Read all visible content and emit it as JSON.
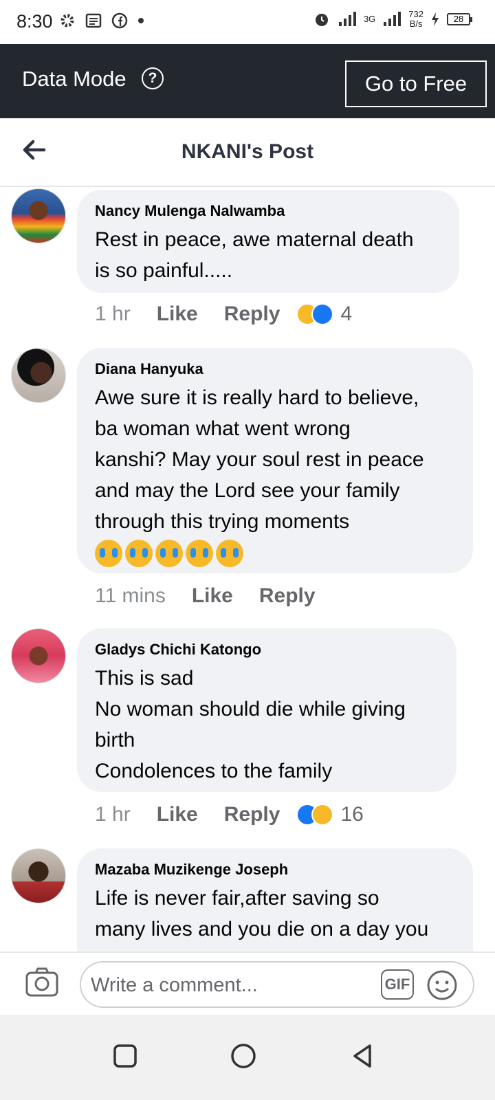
{
  "status_bar": {
    "time": "8:30",
    "network_speed_value": "732",
    "network_speed_unit": "B/s",
    "network_type": "3G",
    "battery": "28"
  },
  "data_mode": {
    "label": "Data Mode",
    "help_glyph": "?",
    "button": "Go to Free"
  },
  "header": {
    "title": "NKANI's Post"
  },
  "comments": [
    {
      "author": "Nancy Mulenga Nalwamba",
      "text": "Rest in peace, awe maternal death\nis so painful.....",
      "time": "1 hr",
      "like": "Like",
      "reply": "Reply",
      "reaction_count": "4"
    },
    {
      "author": "Diana Hanyuka",
      "text": "Awe sure it is really hard to believe,\nba woman what went wrong\nkanshi? May your soul rest in peace\nand may the Lord see your family\nthrough this trying moments",
      "emoji_count": 5,
      "time": "11 mins",
      "like": "Like",
      "reply": "Reply"
    },
    {
      "author": "Gladys Chichi Katongo",
      "text": "This is sad\nNo woman should die while giving\nbirth\nCondolences to the family",
      "time": "1 hr",
      "like": "Like",
      "reply": "Reply",
      "reaction_count": "16"
    },
    {
      "author": "Mazaba Muzikenge Joseph",
      "text": "Life is never fair,after saving so\nmany lives and you die on a day you"
    }
  ],
  "composer": {
    "placeholder": "Write a comment...",
    "gif_label": "GIF"
  },
  "colors": {
    "data_mode_bg": "#23272e",
    "bubble_bg": "#f0f2f5",
    "like_blue": "#1877f2",
    "sad_yellow": "#f7b928"
  }
}
